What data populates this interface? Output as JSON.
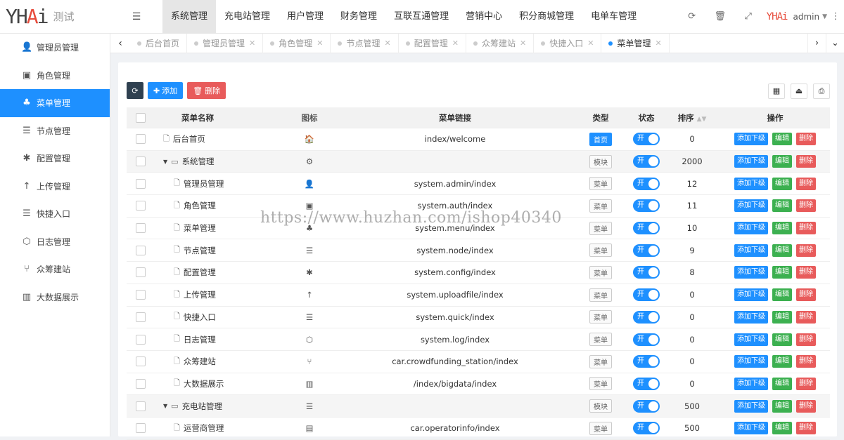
{
  "app": {
    "logo_text": "YHAi",
    "logo_sub": "测试",
    "admin_logo": "YHAi",
    "user": "admin"
  },
  "topnav": [
    "系统管理",
    "充电站管理",
    "用户管理",
    "财务管理",
    "互联互通管理",
    "营销中心",
    "积分商城管理",
    "电单车管理"
  ],
  "sidebar": [
    {
      "label": "管理员管理",
      "icon": "user-icon"
    },
    {
      "label": "角色管理",
      "icon": "role-icon"
    },
    {
      "label": "菜单管理",
      "icon": "tree-icon"
    },
    {
      "label": "节点管理",
      "icon": "list-icon"
    },
    {
      "label": "配置管理",
      "icon": "asterisk-icon"
    },
    {
      "label": "上传管理",
      "icon": "arrow-up-icon"
    },
    {
      "label": "快捷入口",
      "icon": "list-icon"
    },
    {
      "label": "日志管理",
      "icon": "hexagon-icon"
    },
    {
      "label": "众筹建站",
      "icon": "fork-icon"
    },
    {
      "label": "大数据展示",
      "icon": "bar-chart-icon"
    }
  ],
  "tabs": [
    "后台首页",
    "管理员管理",
    "角色管理",
    "节点管理",
    "配置管理",
    "众筹建站",
    "快捷入口",
    "菜单管理"
  ],
  "toolbar": {
    "add": "添加",
    "delete": "删除"
  },
  "table": {
    "headers": {
      "name": "菜单名称",
      "icon": "图标",
      "link": "菜单链接",
      "type": "类型",
      "status": "状态",
      "order": "排序",
      "ops": "操作"
    },
    "rows": [
      {
        "name": "后台首页",
        "link": "index/welcome",
        "type": "首页",
        "order": "0",
        "level": 1
      },
      {
        "name": "系统管理",
        "link": "",
        "type": "模块",
        "order": "2000",
        "level": 0
      },
      {
        "name": "管理员管理",
        "link": "system.admin/index",
        "type": "菜单",
        "order": "12",
        "level": 2
      },
      {
        "name": "角色管理",
        "link": "system.auth/index",
        "type": "菜单",
        "order": "11",
        "level": 2
      },
      {
        "name": "菜单管理",
        "link": "system.menu/index",
        "type": "菜单",
        "order": "10",
        "level": 2
      },
      {
        "name": "节点管理",
        "link": "system.node/index",
        "type": "菜单",
        "order": "9",
        "level": 2
      },
      {
        "name": "配置管理",
        "link": "system.config/index",
        "type": "菜单",
        "order": "8",
        "level": 2
      },
      {
        "name": "上传管理",
        "link": "system.uploadfile/index",
        "type": "菜单",
        "order": "0",
        "level": 2
      },
      {
        "name": "快捷入口",
        "link": "system.quick/index",
        "type": "菜单",
        "order": "0",
        "level": 2
      },
      {
        "name": "日志管理",
        "link": "system.log/index",
        "type": "菜单",
        "order": "0",
        "level": 2
      },
      {
        "name": "众筹建站",
        "link": "car.crowdfunding_station/index",
        "type": "菜单",
        "order": "0",
        "level": 2
      },
      {
        "name": "大数据展示",
        "link": "/index/bigdata/index",
        "type": "菜单",
        "order": "0",
        "level": 2
      },
      {
        "name": "充电站管理",
        "link": "",
        "type": "模块",
        "order": "500",
        "level": 0
      },
      {
        "name": "运营商管理",
        "link": "car.operatorinfo/index",
        "type": "菜单",
        "order": "500",
        "level": 2
      }
    ],
    "status_label": "开",
    "ops": {
      "add_child": "添加下级",
      "edit": "编辑",
      "delete": "删除"
    }
  },
  "watermark": "https://www.huzhan.com/ishop40340"
}
